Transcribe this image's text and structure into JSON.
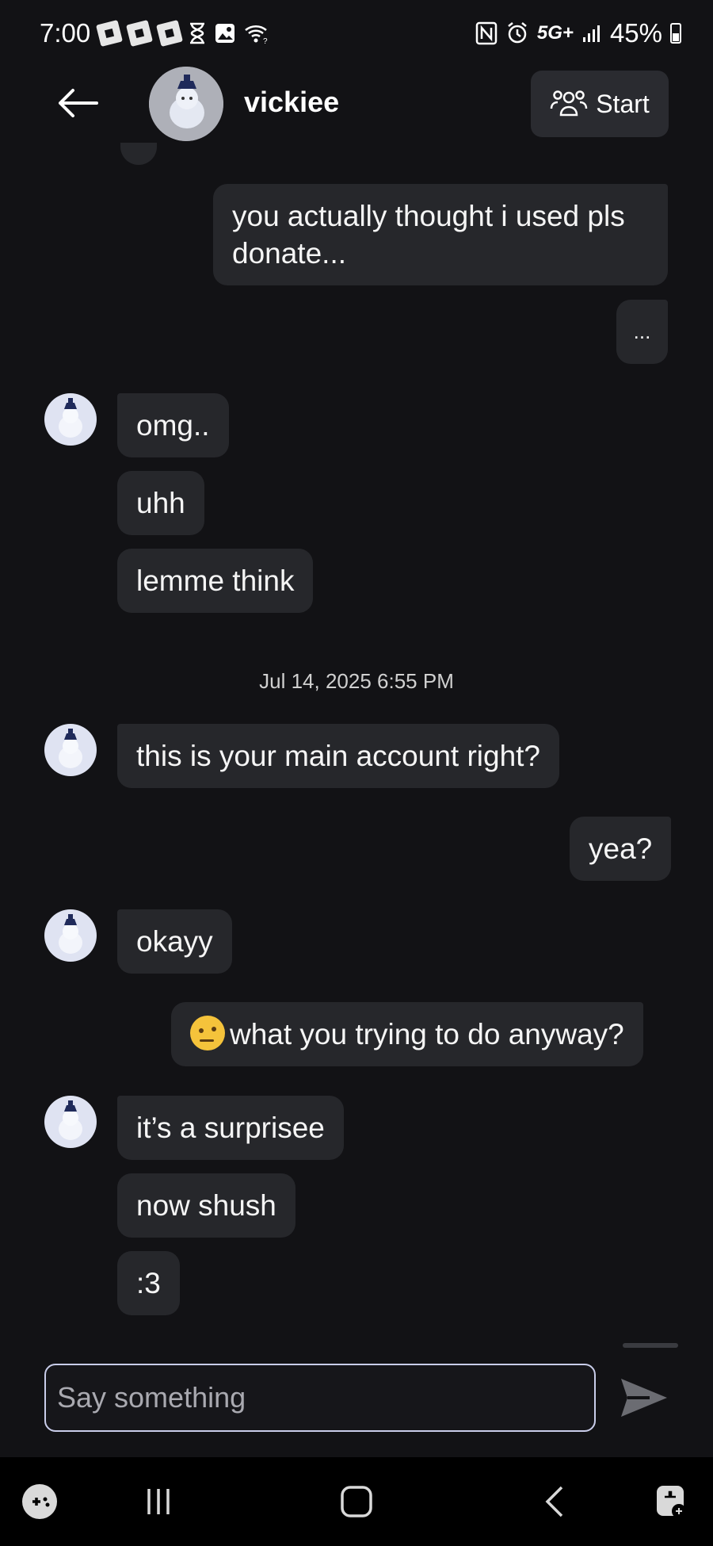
{
  "status_bar": {
    "time": "7:00",
    "network": "5G+",
    "battery": "45%",
    "icons": [
      "roblox-icon",
      "roblox-icon",
      "roblox-icon",
      "hourglass-icon",
      "gallery-icon",
      "wifi-icon",
      "nfc-icon",
      "alarm-icon",
      "signal-icon",
      "battery-icon"
    ]
  },
  "header": {
    "contact_name": "vickiee",
    "start_label": "Start"
  },
  "messages": [
    {
      "side": "out",
      "text": "you actually thought i used pls donate..."
    },
    {
      "side": "out",
      "text": "..."
    },
    {
      "side": "in",
      "text": "omg.."
    },
    {
      "side": "in",
      "text": "uhh"
    },
    {
      "side": "in",
      "text": "lemme think"
    },
    {
      "side": "in",
      "text": "this is your main account right?"
    },
    {
      "side": "out",
      "text": "yea?"
    },
    {
      "side": "in",
      "text": "okayy"
    },
    {
      "side": "out",
      "text": "what you trying to do anyway?",
      "emoji": "raised-eyebrow-emoji"
    },
    {
      "side": "in",
      "text": "it’s a surprisee"
    },
    {
      "side": "in",
      "text": "now shush"
    },
    {
      "side": "in",
      "text": ":3"
    }
  ],
  "timestamp": "Jul 14, 2025 6:55 PM",
  "composer": {
    "placeholder": "Say something"
  },
  "nav_bar": {
    "items": [
      "game-controller-icon",
      "recents-icon",
      "home-icon",
      "back-icon",
      "assistant-icon"
    ]
  },
  "colors": {
    "background": "#121215",
    "bubble": "#26272b",
    "input_border": "#c9cdea"
  }
}
